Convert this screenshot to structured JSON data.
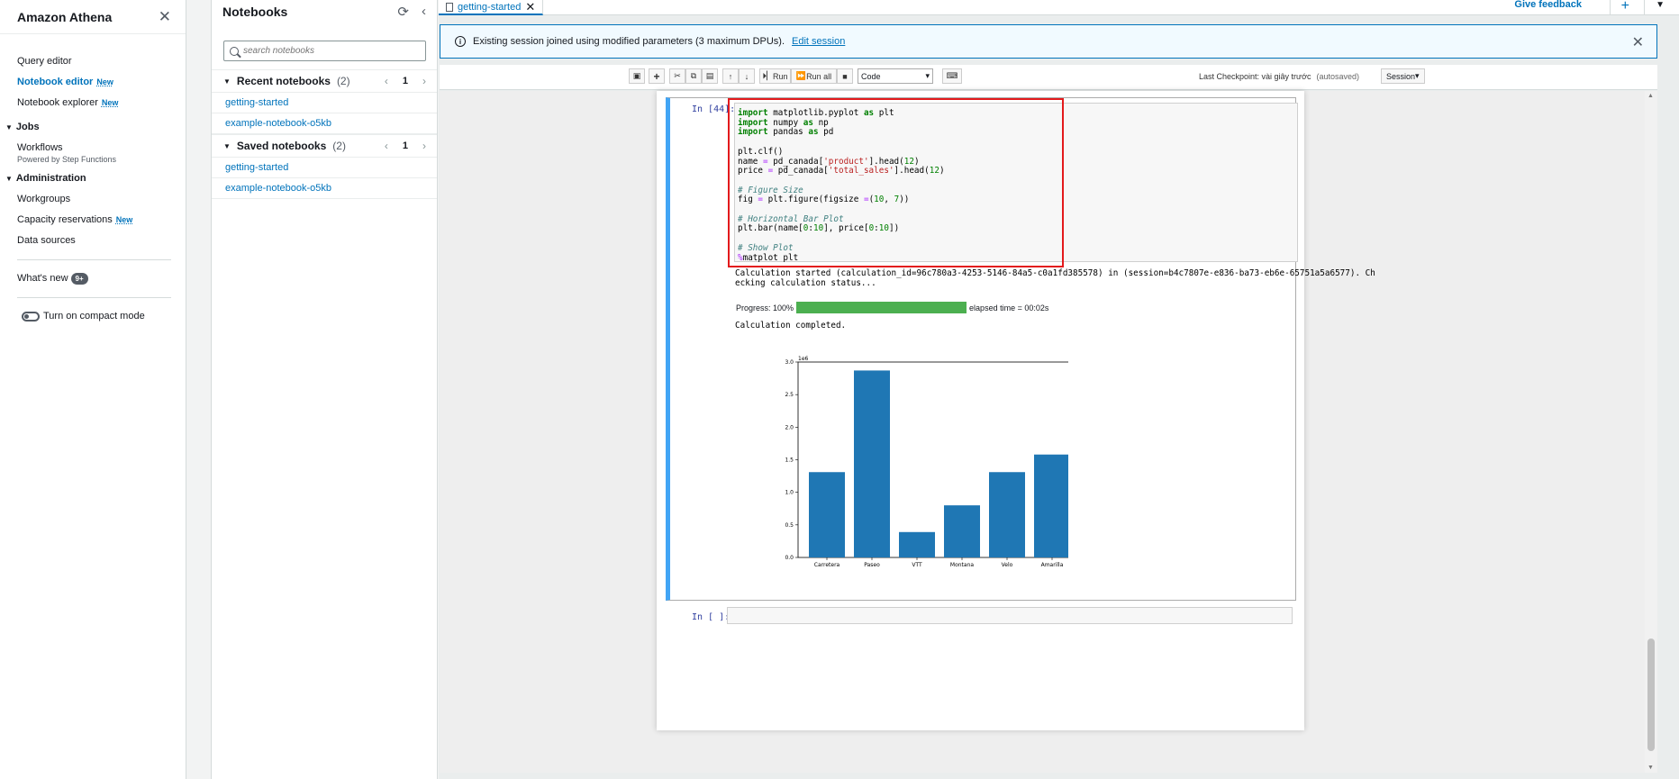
{
  "nav": {
    "title": "Amazon Athena",
    "items": {
      "query_editor": "Query editor",
      "notebook_editor": "Notebook editor",
      "notebook_explorer": "Notebook explorer",
      "new": "New"
    },
    "jobs": {
      "title": "Jobs",
      "workflows": "Workflows",
      "workflows_sub": "Powered by Step Functions"
    },
    "admin": {
      "title": "Administration",
      "workgroups": "Workgroups",
      "capacity": "Capacity reservations",
      "data_sources": "Data sources"
    },
    "whats_new": "What's new",
    "whats_new_count": "9+",
    "compact_mode": "Turn on compact mode"
  },
  "notebooks": {
    "title": "Notebooks",
    "search_placeholder": "search notebooks",
    "recent": {
      "label": "Recent notebooks",
      "count": "(2)",
      "page": "1",
      "items": [
        "getting-started",
        "example-notebook-o5kb"
      ]
    },
    "saved": {
      "label": "Saved notebooks",
      "count": "(2)",
      "page": "1",
      "items": [
        "getting-started",
        "example-notebook-o5kb"
      ]
    }
  },
  "main": {
    "tab_label": "getting-started",
    "give_feedback": "Give feedback",
    "flash": {
      "message": "Existing session joined using modified parameters (3 maximum DPUs).",
      "link": "Edit session"
    },
    "toolbar": {
      "run": "Run",
      "run_all": "Run all",
      "cell_type": "Code",
      "checkpoint": "Last Checkpoint: vài giây trước",
      "autosaved": "(autosaved)",
      "session": "Session"
    },
    "cell1": {
      "prompt": "In [44]:",
      "output_line1": "Calculation started (calculation_id=96c780a3-4253-5146-84a5-c0a1fd385578) in (session=b4c7807e-e836-ba73-eb6e-65751a5a6577). Ch",
      "output_line2": "ecking calculation status...",
      "progress_label": "Progress: 100%",
      "elapsed": "elapsed time = 00:02s",
      "completed": "Calculation completed."
    },
    "cell2": {
      "prompt": "In [ ]:"
    }
  },
  "chart_data": {
    "type": "bar",
    "categories": [
      "Carretera",
      "Paseo",
      "VTT",
      "Montana",
      "Velo",
      "Amarilla"
    ],
    "values": [
      1310000,
      2870000,
      390000,
      800000,
      1310000,
      1580000
    ],
    "ylim": [
      0,
      3000000
    ],
    "yticks": [
      "0.0",
      "0.5",
      "1.0",
      "1.5",
      "2.0",
      "2.5",
      "3.0"
    ],
    "scale_label": "1e6",
    "bar_color": "#1f77b4",
    "grid": false
  },
  "progress": 1.0,
  "colors": {
    "accent": "#0073bb",
    "progress": "#4caf50",
    "cell_active": "#42a5f5",
    "highlight": "#e31a1c"
  }
}
